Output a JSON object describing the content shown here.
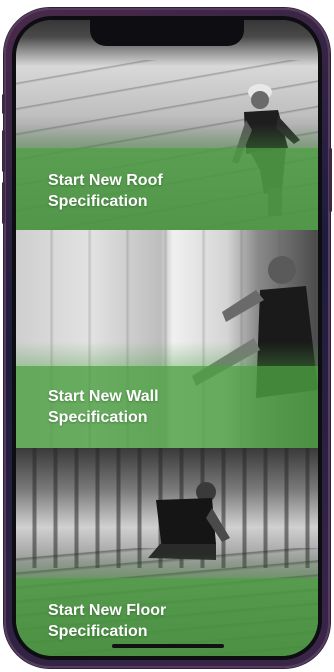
{
  "tiles": [
    {
      "label_line1": "Start New Roof",
      "label_line2": "Specification"
    },
    {
      "label_line1": "Start New Wall",
      "label_line2": "Specification"
    },
    {
      "label_line1": "Start New Floor",
      "label_line2": "Specification"
    }
  ],
  "colors": {
    "accent_green": "#4CA042",
    "phone_frame": "#2A2438",
    "label_text": "#FFFFFF"
  }
}
